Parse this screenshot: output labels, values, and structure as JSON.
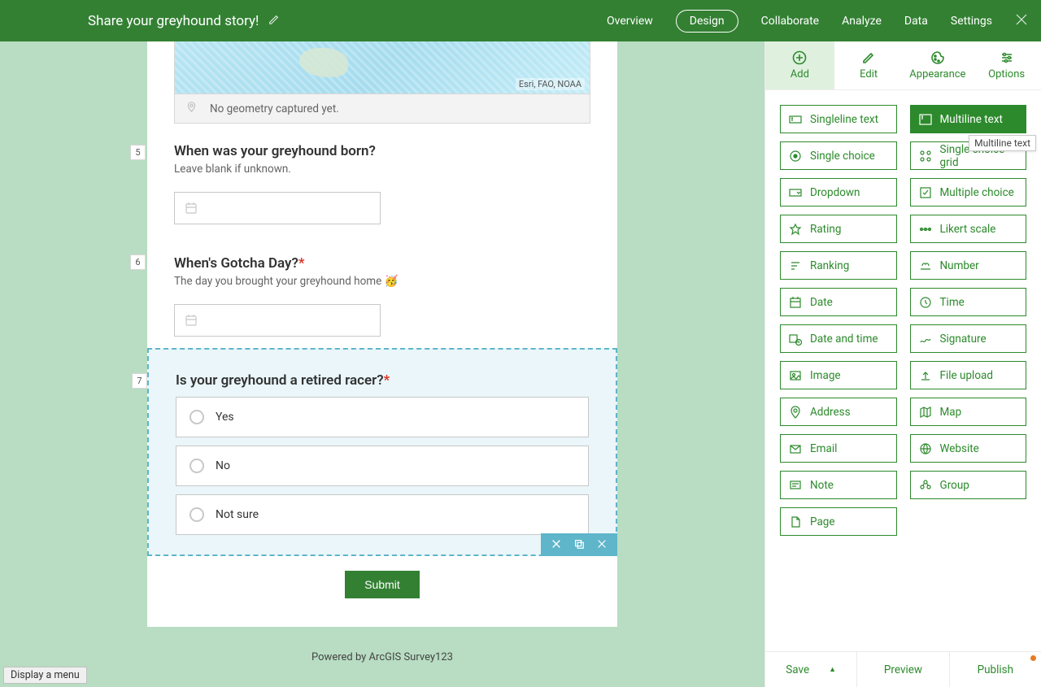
{
  "header": {
    "title": "Share your greyhound story!",
    "nav": [
      "Overview",
      "Design",
      "Collaborate",
      "Analyze",
      "Data",
      "Settings"
    ],
    "active": "Design"
  },
  "map": {
    "credits": "Esri, FAO, NOAA",
    "status": "No geometry captured yet."
  },
  "q5": {
    "num": "5",
    "title": "When was your greyhound born?",
    "hint": "Leave blank if unknown."
  },
  "q6": {
    "num": "6",
    "title": "When's Gotcha Day?",
    "hint": "The day you brought your greyhound home 🥳"
  },
  "q7": {
    "num": "7",
    "title": "Is your greyhound a retired racer?",
    "choices": [
      "Yes",
      "No",
      "Not sure"
    ]
  },
  "submit": "Submit",
  "powered": "Powered by ArcGIS Survey123",
  "panel": {
    "tabs": [
      "Add",
      "Edit",
      "Appearance",
      "Options"
    ],
    "activeTab": "Add",
    "fields_left": [
      "Singleline text",
      "Single choice",
      "Dropdown",
      "Rating",
      "Ranking",
      "Date",
      "Date and time",
      "Image",
      "Address",
      "Email",
      "Note",
      "Page"
    ],
    "fields_right": [
      "Multiline text",
      "Single choice grid",
      "Multiple choice",
      "Likert scale",
      "Number",
      "Time",
      "Signature",
      "File upload",
      "Map",
      "Website",
      "Group"
    ],
    "selected": "Multiline text",
    "tooltip": "Multiline text"
  },
  "bottom": {
    "save": "Save",
    "preview": "Preview",
    "publish": "Publish"
  },
  "displayMenu": "Display a menu"
}
